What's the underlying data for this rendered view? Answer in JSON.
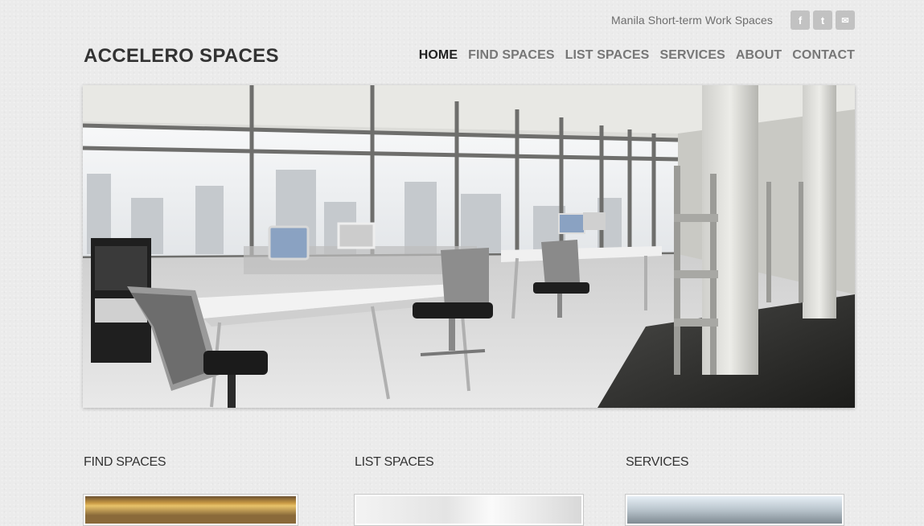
{
  "header": {
    "tagline": "Manila Short-term Work Spaces",
    "brand": "ACCELERO SPACES",
    "social": [
      {
        "icon": "facebook-icon",
        "glyph": "f"
      },
      {
        "icon": "twitter-icon",
        "glyph": "t"
      },
      {
        "icon": "email-icon",
        "glyph": "✉"
      }
    ]
  },
  "nav": [
    {
      "label": "HOME",
      "active": true
    },
    {
      "label": "FIND SPACES",
      "active": false
    },
    {
      "label": "LIST SPACES",
      "active": false
    },
    {
      "label": "SERVICES",
      "active": false
    },
    {
      "label": "ABOUT",
      "active": false
    },
    {
      "label": "CONTACT",
      "active": false
    }
  ],
  "sections": [
    {
      "title": "FIND SPACES"
    },
    {
      "title": "LIST SPACES"
    },
    {
      "title": "SERVICES"
    }
  ],
  "colors": {
    "background": "#ebebeb",
    "text": "#333333",
    "nav_inactive": "#777777",
    "social_bg": "#c2c2c2"
  }
}
